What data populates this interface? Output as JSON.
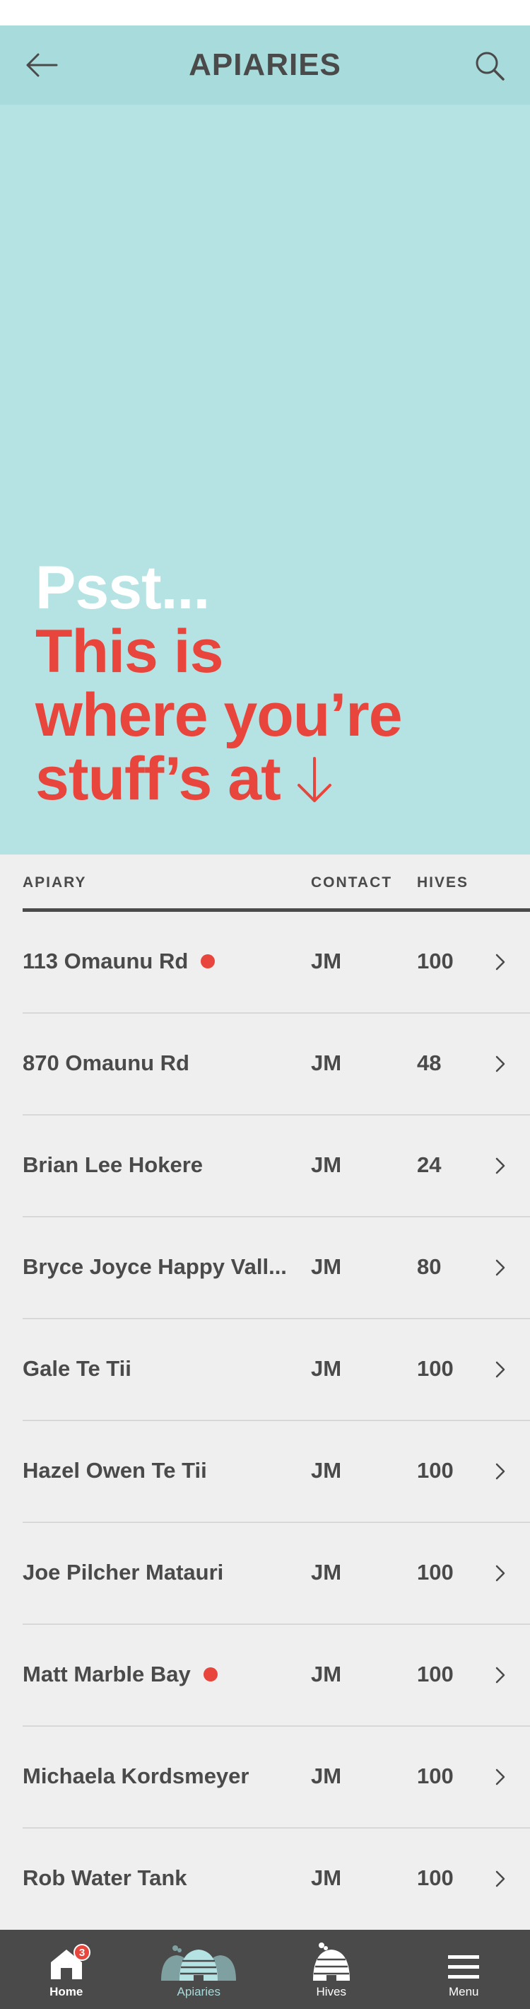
{
  "header": {
    "title": "APIARIES",
    "back_icon": "arrow-left-icon",
    "search_icon": "search-icon"
  },
  "hero": {
    "line1": "Psst...",
    "line2": "This is",
    "line3": "where you’re",
    "line4": "stuff’s at",
    "arrow_icon": "arrow-down-icon",
    "colors": {
      "background": "#b5e3e3",
      "accent": "#e8463d"
    }
  },
  "table": {
    "columns": [
      "APIARY",
      "CONTACT",
      "HIVES"
    ],
    "rows": [
      {
        "name": "113 Omaunu Rd",
        "flag": true,
        "contact": "JM",
        "hives": "100"
      },
      {
        "name": "870 Omaunu Rd",
        "flag": false,
        "contact": "JM",
        "hives": "48"
      },
      {
        "name": "Brian Lee Hokere",
        "flag": false,
        "contact": "JM",
        "hives": "24"
      },
      {
        "name": "Bryce Joyce Happy Vall...",
        "flag": false,
        "contact": "JM",
        "hives": "80"
      },
      {
        "name": "Gale Te Tii",
        "flag": false,
        "contact": "JM",
        "hives": "100"
      },
      {
        "name": "Hazel Owen Te Tii",
        "flag": false,
        "contact": "JM",
        "hives": "100"
      },
      {
        "name": "Joe Pilcher Matauri",
        "flag": false,
        "contact": "JM",
        "hives": "100"
      },
      {
        "name": "Matt Marble Bay",
        "flag": true,
        "contact": "JM",
        "hives": "100"
      },
      {
        "name": "Michaela Kordsmeyer",
        "flag": false,
        "contact": "JM",
        "hives": "100"
      },
      {
        "name": "Rob Water Tank",
        "flag": false,
        "contact": "JM",
        "hives": "100"
      }
    ]
  },
  "tabbar": {
    "tabs": [
      {
        "label": "Home",
        "icon": "home-icon",
        "badge": "3",
        "active": false
      },
      {
        "label": "Apiaries",
        "icon": "apiaries-icon",
        "active": true
      },
      {
        "label": "Hives",
        "icon": "hive-icon",
        "active": false
      },
      {
        "label": "Menu",
        "icon": "menu-icon",
        "active": false
      }
    ]
  }
}
